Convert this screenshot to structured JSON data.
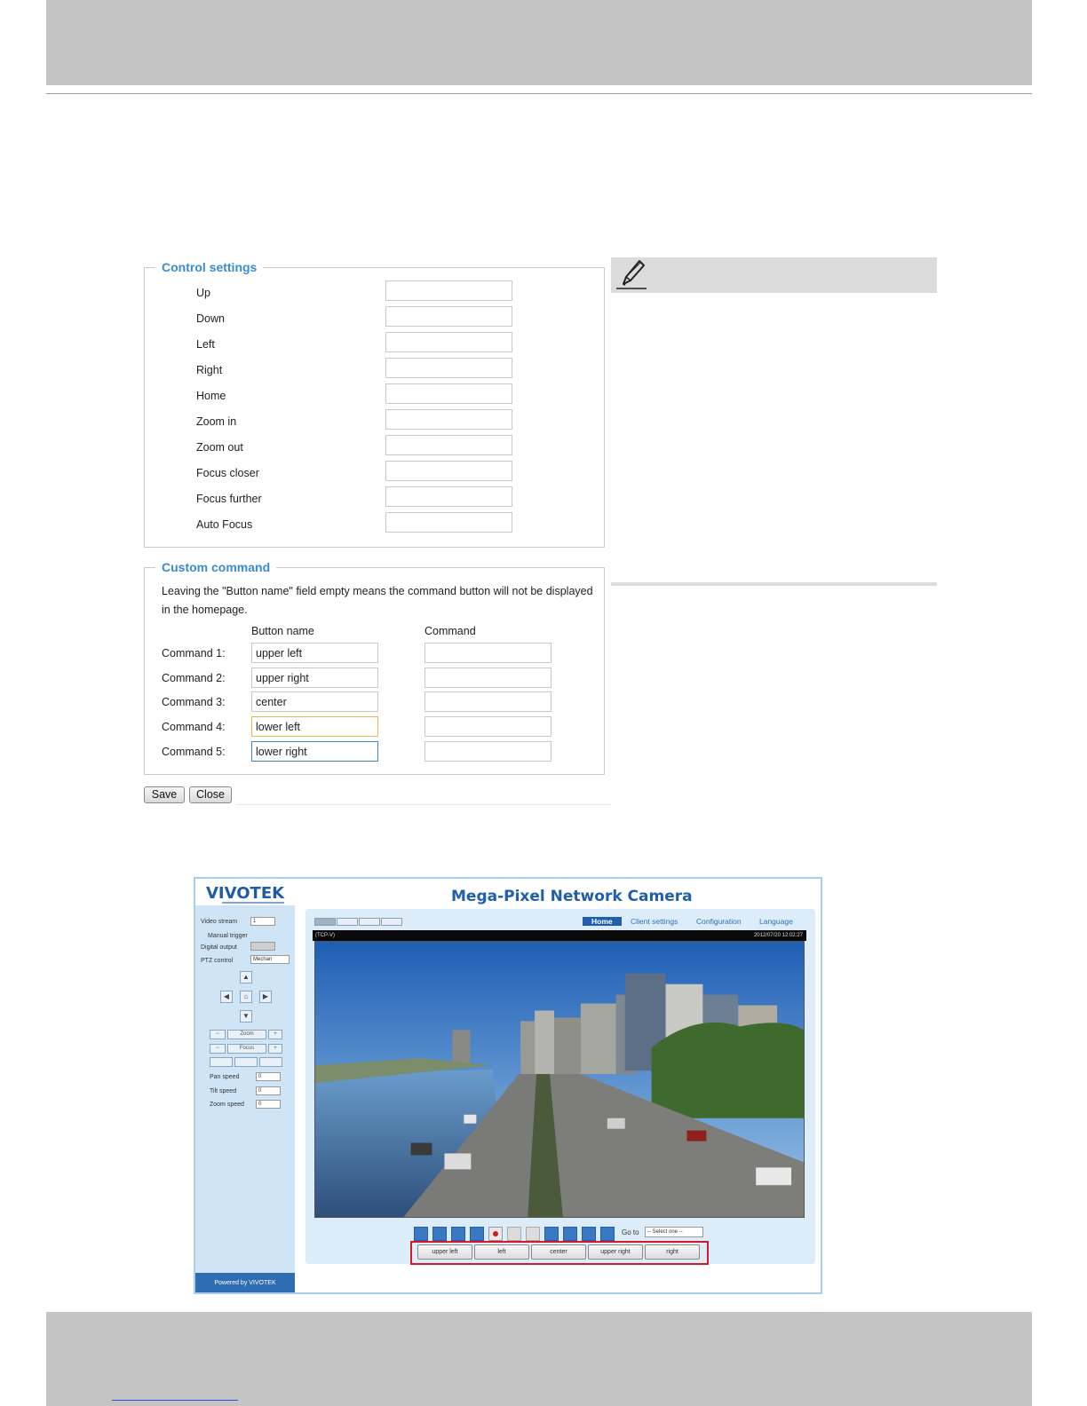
{
  "control_settings": {
    "legend": "Control settings",
    "rows": [
      {
        "label": "Up",
        "value": ""
      },
      {
        "label": "Down",
        "value": ""
      },
      {
        "label": "Left",
        "value": ""
      },
      {
        "label": "Right",
        "value": ""
      },
      {
        "label": "Home",
        "value": ""
      },
      {
        "label": "Zoom in",
        "value": ""
      },
      {
        "label": "Zoom out",
        "value": ""
      },
      {
        "label": "Focus closer",
        "value": ""
      },
      {
        "label": "Focus further",
        "value": ""
      },
      {
        "label": "Auto Focus",
        "value": ""
      }
    ]
  },
  "custom_command": {
    "legend": "Custom command",
    "description": "Leaving the \"Button name\" field empty means the command button will not be displayed in the homepage.",
    "col_button_name": "Button name",
    "col_command": "Command",
    "rows": [
      {
        "label": "Command 1:",
        "button_name": "upper left",
        "command": ""
      },
      {
        "label": "Command 2:",
        "button_name": "upper right",
        "command": ""
      },
      {
        "label": "Command 3:",
        "button_name": "center",
        "command": ""
      },
      {
        "label": "Command 4:",
        "button_name": "lower left",
        "command": ""
      },
      {
        "label": "Command 5:",
        "button_name": "lower right",
        "command": ""
      }
    ]
  },
  "actions": {
    "save": "Save",
    "close": "Close"
  },
  "camera": {
    "logo": "VIVOTEK",
    "title": "Mega-Pixel Network Camera",
    "nav": {
      "home": "Home",
      "client": "Client settings",
      "config": "Configuration",
      "language": "Language"
    },
    "video_stream_label": "Video stream",
    "video_stream_value": "1",
    "manual_trigger_label": "Manual trigger",
    "digital_output_label": "Digital output",
    "ptz_control_label": "PTZ control",
    "ptz_control_value": "Mechan",
    "zoom_label": "Zoom",
    "focus_label": "Focus",
    "pan_speed_label": "Pan speed",
    "pan_speed_value": "0",
    "tilt_speed_label": "Tilt speed",
    "tilt_speed_value": "0",
    "zoom_speed_label": "Zoom speed",
    "zoom_speed_value": "0",
    "video_caption": "(TCP-V)",
    "video_time": "2012/07/20 12:02:27",
    "goto_label": "Go to",
    "goto_value": "-- Select one --",
    "powered_by": "Powered by VIVOTEK",
    "command_buttons": [
      "upper left",
      "left",
      "center",
      "upper right",
      "right"
    ]
  },
  "colors": {
    "legend": "#3a8bd0",
    "highlight": "#cf1b2b",
    "brand": "#1f5fae"
  }
}
